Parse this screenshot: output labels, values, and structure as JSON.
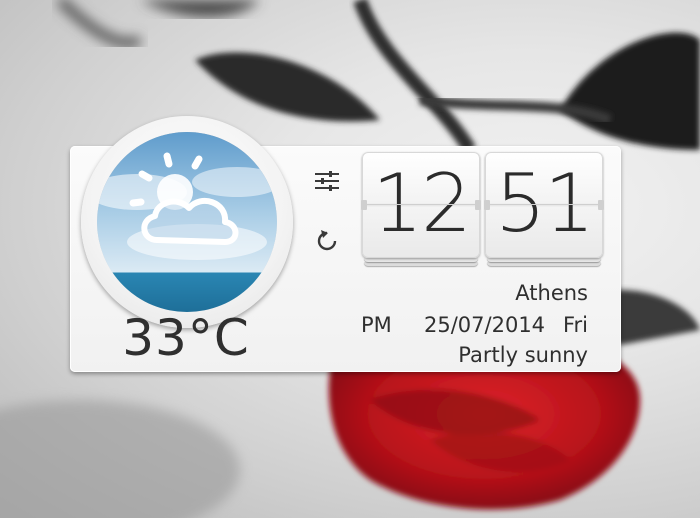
{
  "weather": {
    "temperature": "33°C",
    "condition": "Partly sunny",
    "city": "Athens",
    "icon": "partly-sunny-icon"
  },
  "clock": {
    "hours": "12",
    "minutes": "51",
    "ampm": "PM",
    "date": "25/07/2014",
    "weekday": "Fri"
  },
  "controls": {
    "settings_icon": "sliders-icon",
    "refresh_icon": "refresh-icon"
  },
  "colors": {
    "text": "#2f2f2f",
    "panel": "#f5f5f5",
    "sky_top": "#7fb0d6",
    "sea": "#2a86b3",
    "rose": "#c4141b"
  }
}
